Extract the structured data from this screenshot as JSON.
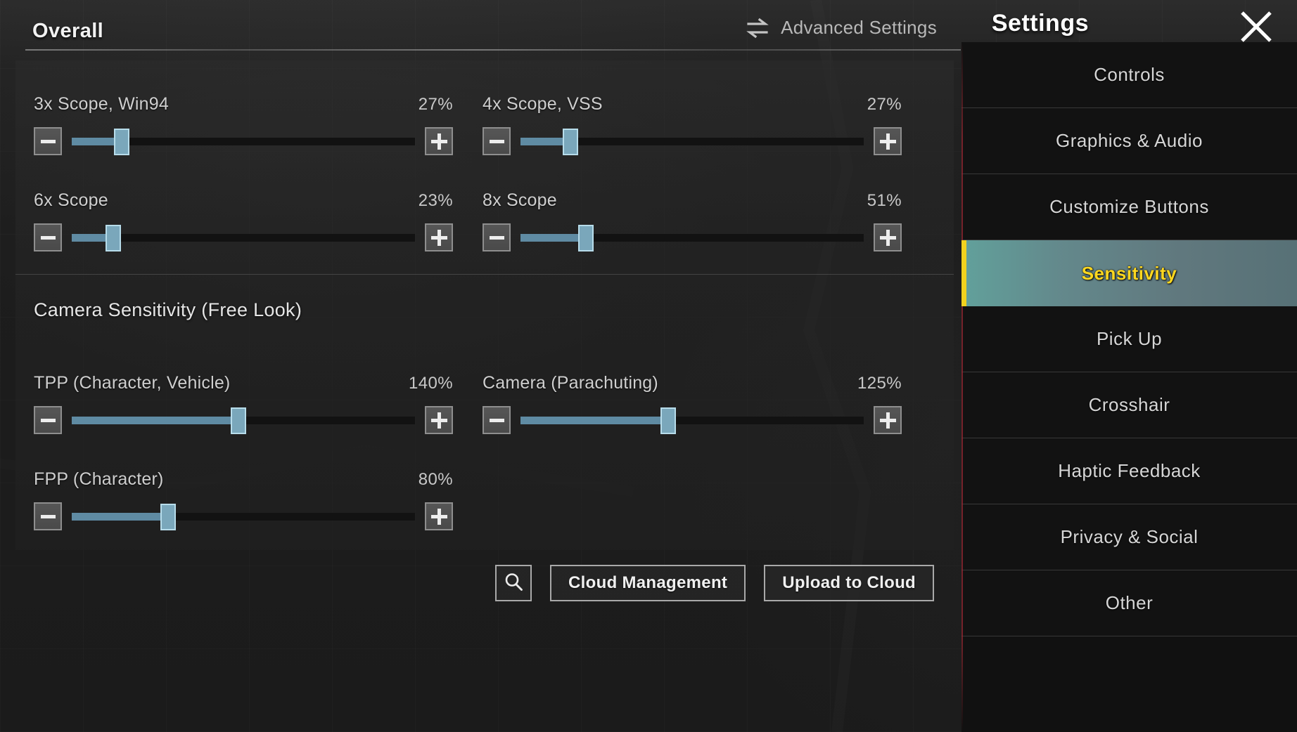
{
  "header": {
    "overall_label": "Overall",
    "advanced_settings_label": "Advanced Settings",
    "advanced_settings_icon": "swap-arrows-icon",
    "settings_title": "Settings",
    "close_icon": "close-icon"
  },
  "sections": [
    {
      "title": "",
      "sliders": [
        {
          "label": "3x Scope, Win94",
          "value": "27%",
          "fill_pct": 14.5,
          "minus_icon": "minus-icon",
          "plus_icon": "plus-icon"
        },
        {
          "label": "4x Scope, VSS",
          "value": "27%",
          "fill_pct": 14.5,
          "minus_icon": "minus-icon",
          "plus_icon": "plus-icon"
        },
        {
          "label": "6x Scope",
          "value": "23%",
          "fill_pct": 12.0,
          "minus_icon": "minus-icon",
          "plus_icon": "plus-icon"
        },
        {
          "label": "8x Scope",
          "value": "51%",
          "fill_pct": 19.0,
          "minus_icon": "minus-icon",
          "plus_icon": "plus-icon"
        }
      ]
    },
    {
      "title": "Camera Sensitivity (Free Look)",
      "sliders": [
        {
          "label": "TPP (Character, Vehicle)",
          "value": "140%",
          "fill_pct": 48.5,
          "minus_icon": "minus-icon",
          "plus_icon": "plus-icon"
        },
        {
          "label": "Camera (Parachuting)",
          "value": "125%",
          "fill_pct": 43.0,
          "minus_icon": "minus-icon",
          "plus_icon": "plus-icon"
        },
        {
          "label": "FPP (Character)",
          "value": "80%",
          "fill_pct": 28.0,
          "minus_icon": "minus-icon",
          "plus_icon": "plus-icon"
        }
      ]
    }
  ],
  "bottom_bar": {
    "search_icon": "search-icon",
    "cloud_management_label": "Cloud Management",
    "upload_to_cloud_label": "Upload to Cloud"
  },
  "sidebar": {
    "items": [
      {
        "label": "Controls",
        "active": false
      },
      {
        "label": "Graphics & Audio",
        "active": false
      },
      {
        "label": "Customize Buttons",
        "active": false
      },
      {
        "label": "Sensitivity",
        "active": true
      },
      {
        "label": "Pick Up",
        "active": false
      },
      {
        "label": "Crosshair",
        "active": false
      },
      {
        "label": "Haptic Feedback",
        "active": false
      },
      {
        "label": "Privacy & Social",
        "active": false
      },
      {
        "label": "Other",
        "active": false
      }
    ]
  },
  "colors": {
    "accent_selected_text": "#ffd81f",
    "accent_selected_bg": "#68ada7",
    "slider_fill": "#5f8ba3",
    "slider_handle": "#7aa7bb",
    "panel_bg": "#2a2a2a"
  }
}
